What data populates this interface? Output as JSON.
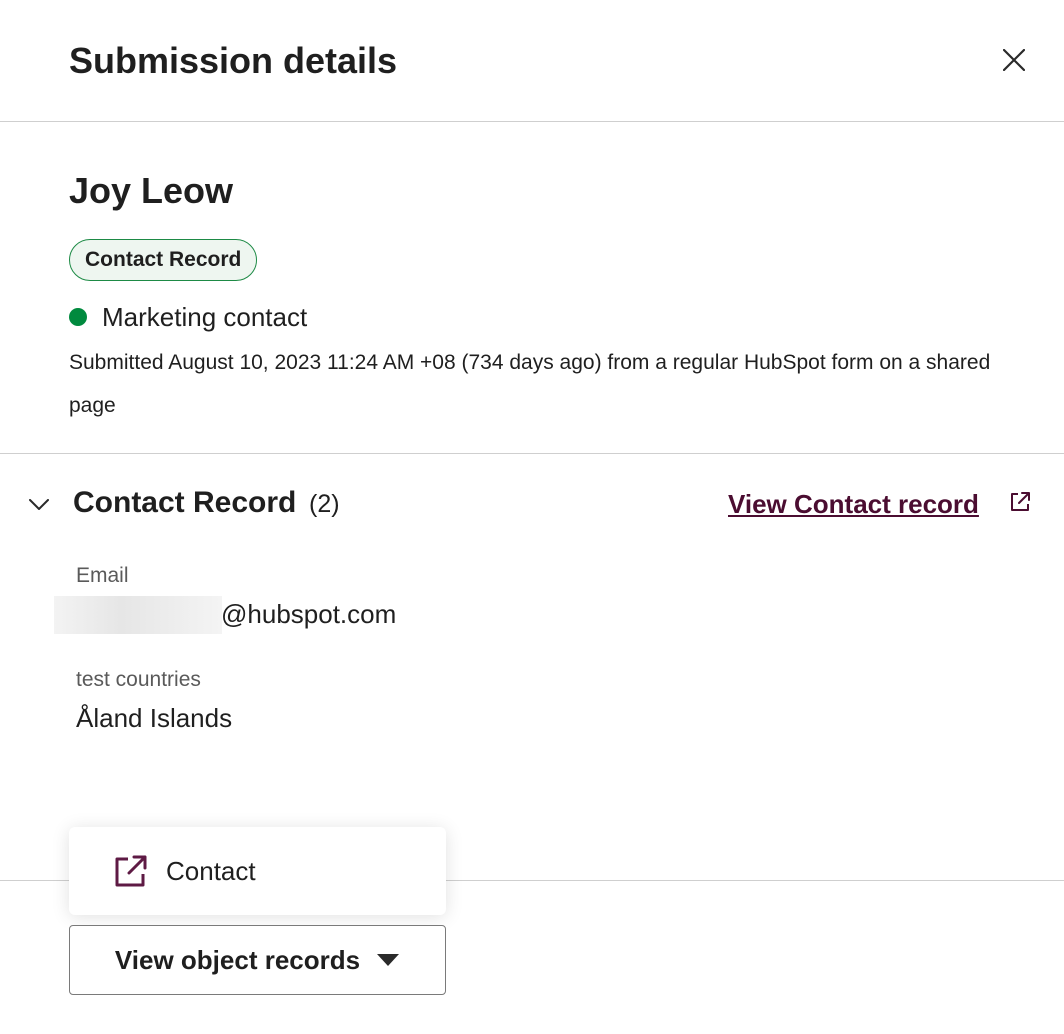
{
  "header": {
    "title": "Submission details",
    "close_icon": "close-icon"
  },
  "summary": {
    "name": "Joy Leow",
    "badge": "Contact Record",
    "status": "Marketing contact",
    "status_color": "#008a3e",
    "submitted": "Submitted August 10, 2023 11:24 AM +08 (734 days ago) from a regular HubSpot form on a shared page"
  },
  "section": {
    "title": "Contact Record",
    "count": "(2)",
    "link": "View Contact record",
    "link_color": "#4b0d31",
    "fields": [
      {
        "label": "Email",
        "value": "@hubspot.com"
      },
      {
        "label": "test countries",
        "value": "Åland Islands"
      }
    ]
  },
  "dropdown": {
    "items": [
      {
        "label": "Contact",
        "icon": "external-link-icon"
      }
    ]
  },
  "footer": {
    "button_label": "View object records"
  }
}
